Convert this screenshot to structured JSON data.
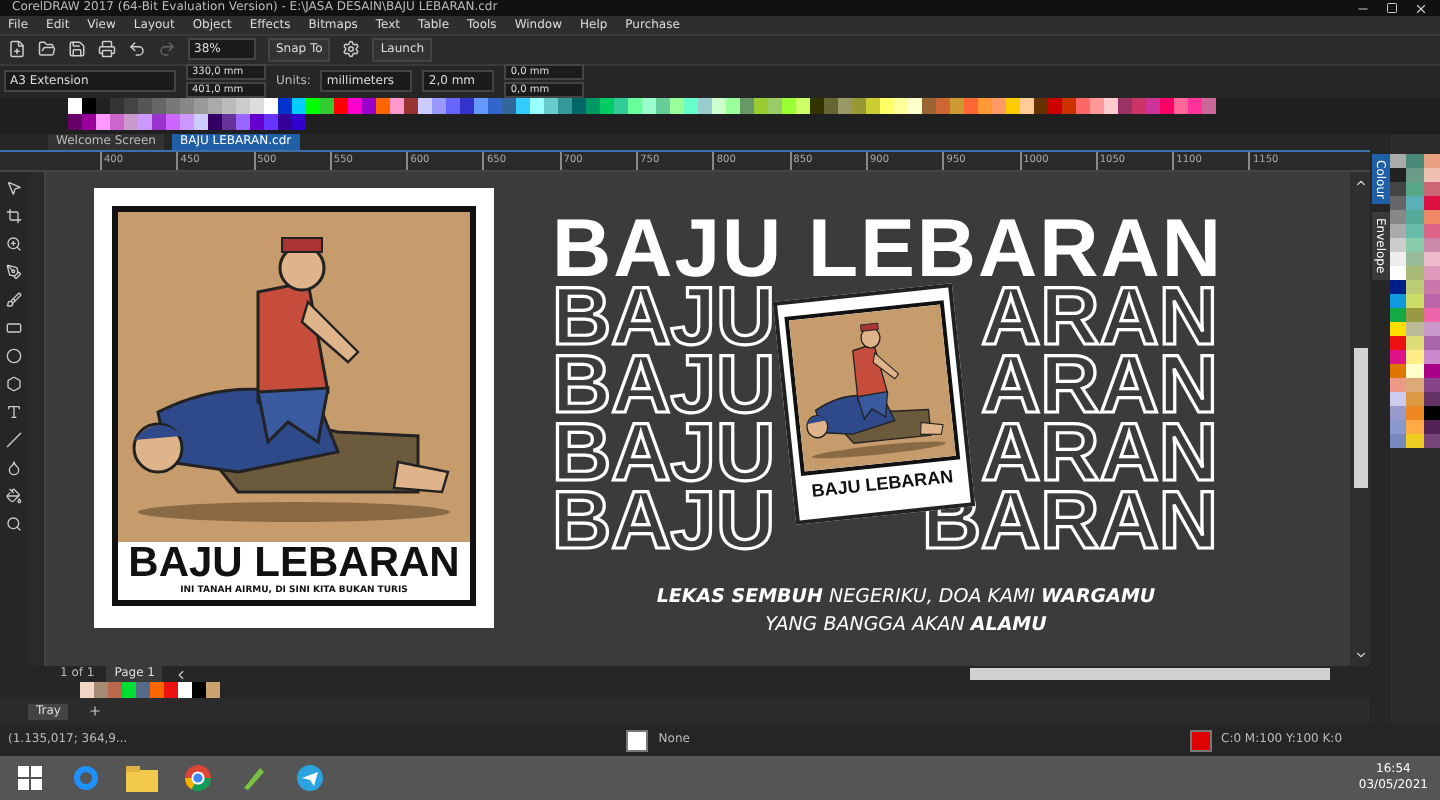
{
  "window": {
    "title": "CorelDRAW 2017 (64-Bit Evaluation Version) - E:\\JASA DESAIN\\BAJU LEBARAN.cdr"
  },
  "menu": [
    "File",
    "Edit",
    "View",
    "Layout",
    "Object",
    "Effects",
    "Bitmaps",
    "Text",
    "Table",
    "Tools",
    "Window",
    "Help",
    "Purchase"
  ],
  "toolbar": {
    "zoom": "38%",
    "snap": "Snap To",
    "launch": "Launch"
  },
  "property_bar": {
    "page_size": "A3 Extension",
    "width": "330,0 mm",
    "height": "401,0 mm",
    "units_label": "Units:",
    "units": "millimeters",
    "nudge": "2,0 mm",
    "dup_x": "0,0 mm",
    "dup_y": "0,0 mm"
  },
  "document_tabs": [
    {
      "label": "Welcome Screen",
      "selected": false
    },
    {
      "label": "BAJU LEBARAN.cdr",
      "selected": true
    }
  ],
  "ruler": [
    "400",
    "450",
    "500",
    "550",
    "600",
    "650",
    "700",
    "750",
    "800",
    "850",
    "900",
    "950",
    "1000",
    "1050",
    "1100",
    "1150"
  ],
  "dockers": [
    "Colour",
    "Envelope"
  ],
  "design": {
    "poster": {
      "title": "BAJU LEBARAN",
      "tagline": "INI TANAH AIRMU, DI SINI KITA BUKAN TURIS"
    },
    "headline": "BAJU LEBARAN",
    "repeats": [
      {
        "left": "BAJU",
        "right": "ARAN"
      },
      {
        "left": "BAJU",
        "right": "ARAN"
      },
      {
        "left": "BAJU",
        "right": "ARAN"
      },
      {
        "left": "BAJU",
        "right": "BARAN"
      }
    ],
    "sticker": {
      "title": "BAJU LEBARAN"
    },
    "caption": [
      "**LEKAS SEMBUH** NEGERIKU, DOA KAMI **WARGAMU**",
      "YANG BANGGA AKAN **ALAMU**"
    ]
  },
  "page_nav": {
    "position": "1 of 1",
    "page_tab": "Page 1"
  },
  "tray": {
    "label": "Tray"
  },
  "status_bar": {
    "coordinates": "(1.135,017; 364,9...",
    "fill": "None",
    "outline": "C:0 M:100 Y:100 K:0"
  },
  "taskbar": {
    "time": "16:54",
    "date": "03/05/2021"
  }
}
